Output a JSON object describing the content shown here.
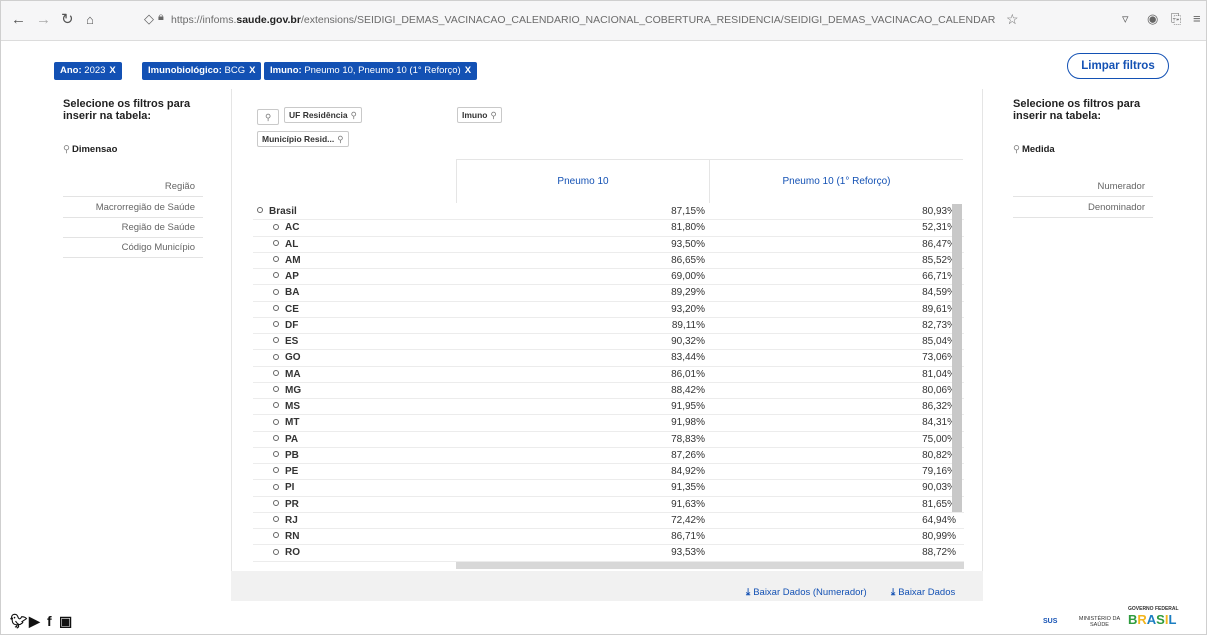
{
  "browser": {
    "url_prefix": "https://infoms.",
    "url_domain": "saude.gov.br",
    "url_path": "/extensions/SEIDIGI_DEMAS_VACINACAO_CALENDARIO_NACIONAL_COBERTURA_RESIDENCIA/SEIDIGI_DEMAS_VACINACAO_CALENDARIO_NACIONAL_COBERTURA_RESIDENCIA.htm"
  },
  "chips": [
    {
      "key": "Ano:",
      "value": "2023",
      "close": "X"
    },
    {
      "key": "Imunobiológico:",
      "value": "BCG",
      "close": "X"
    },
    {
      "key": "Imuno:",
      "value": "Pneumo 10, Pneumo 10 (1° Reforço)",
      "close": "X"
    }
  ],
  "clear_filters": "Limpar filtros",
  "left_panel": {
    "title_line1": "Selecione os filtros para",
    "title_line2": "inserir na tabela:",
    "search_label": "Dimensao",
    "items": [
      "Região",
      "Macrorregião de Saúde",
      "Região de Saúde",
      "Código Município"
    ]
  },
  "right_panel": {
    "title_line1": "Selecione os filtros para",
    "title_line2": "inserir na tabela:",
    "search_label": "Medida",
    "items": [
      "Numerador",
      "Denominador"
    ]
  },
  "table": {
    "row_filters": [
      "UF Residência",
      "Município Resid..."
    ],
    "col_filter": "Imuno",
    "columns": [
      "Pneumo 10",
      "Pneumo 10 (1° Reforço)"
    ],
    "rows": [
      {
        "label": "Brasil",
        "v1": "87,15%",
        "v2": "80,93%"
      },
      {
        "label": "AC",
        "v1": "81,80%",
        "v2": "52,31%"
      },
      {
        "label": "AL",
        "v1": "93,50%",
        "v2": "86,47%"
      },
      {
        "label": "AM",
        "v1": "86,65%",
        "v2": "85,52%"
      },
      {
        "label": "AP",
        "v1": "69,00%",
        "v2": "66,71%"
      },
      {
        "label": "BA",
        "v1": "89,29%",
        "v2": "84,59%"
      },
      {
        "label": "CE",
        "v1": "93,20%",
        "v2": "89,61%"
      },
      {
        "label": "DF",
        "v1": "89,11%",
        "v2": "82,73%"
      },
      {
        "label": "ES",
        "v1": "90,32%",
        "v2": "85,04%"
      },
      {
        "label": "GO",
        "v1": "83,44%",
        "v2": "73,06%"
      },
      {
        "label": "MA",
        "v1": "86,01%",
        "v2": "81,04%"
      },
      {
        "label": "MG",
        "v1": "88,42%",
        "v2": "80,06%"
      },
      {
        "label": "MS",
        "v1": "91,95%",
        "v2": "86,32%"
      },
      {
        "label": "MT",
        "v1": "91,98%",
        "v2": "84,31%"
      },
      {
        "label": "PA",
        "v1": "78,83%",
        "v2": "75,00%"
      },
      {
        "label": "PB",
        "v1": "87,26%",
        "v2": "80,82%"
      },
      {
        "label": "PE",
        "v1": "84,92%",
        "v2": "79,16%"
      },
      {
        "label": "PI",
        "v1": "91,35%",
        "v2": "90,03%"
      },
      {
        "label": "PR",
        "v1": "91,63%",
        "v2": "81,65%"
      },
      {
        "label": "RJ",
        "v1": "72,42%",
        "v2": "64,94%"
      },
      {
        "label": "RN",
        "v1": "86,71%",
        "v2": "80,99%"
      },
      {
        "label": "RO",
        "v1": "93,53%",
        "v2": "88,72%"
      }
    ]
  },
  "downloads": [
    "Baixar Dados (Numerador)",
    "Baixar Dados"
  ],
  "footer": {
    "sus": "SUS",
    "ministerio": "MINISTÉRIO DA SAÚDE",
    "gov_federal": "GOVERNO FEDERAL",
    "brasil": "BRASIL"
  },
  "colors": {
    "accent": "#1351b4"
  }
}
